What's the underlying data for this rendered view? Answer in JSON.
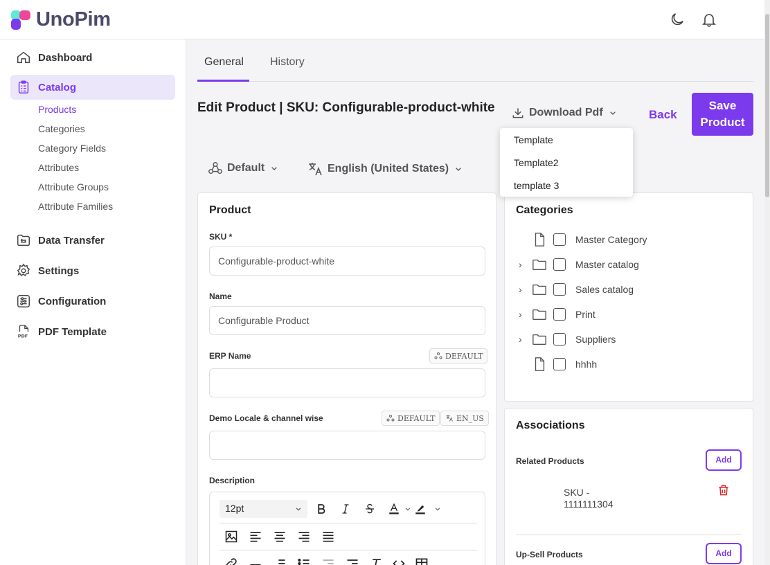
{
  "brand": {
    "name": "UnoPim"
  },
  "sidebar": {
    "items": [
      {
        "label": "Dashboard",
        "icon": "home-icon"
      },
      {
        "label": "Catalog",
        "icon": "clipboard-icon"
      },
      {
        "label": "Data Transfer",
        "icon": "folder-transfer-icon"
      },
      {
        "label": "Settings",
        "icon": "gear-icon"
      },
      {
        "label": "Configuration",
        "icon": "sliders-icon"
      },
      {
        "label": "PDF Template",
        "icon": "pdf-icon"
      }
    ],
    "catalog_sub": [
      "Products",
      "Categories",
      "Category Fields",
      "Attributes",
      "Attribute Groups",
      "Attribute Families"
    ]
  },
  "tabs": [
    "General",
    "History"
  ],
  "header": {
    "title": "Edit Product | SKU: Configurable-product-white",
    "download_label": "Download Pdf",
    "back_label": "Back",
    "save_label": "Save Product"
  },
  "download_menu": [
    "Template",
    "Template2",
    "template 3"
  ],
  "switchers": {
    "channel": "Default",
    "locale": "English (United States)"
  },
  "product_card": {
    "title": "Product",
    "sku_label": "SKU *",
    "sku_value": "Configurable-product-white",
    "name_label": "Name",
    "name_value": "Configurable Product",
    "erp_label": "ERP Name",
    "erp_chip": "DEFAULT",
    "demo_label": "Demo Locale & channel wise",
    "demo_chip_channel": "DEFAULT",
    "demo_chip_locale": "EN_US",
    "description_label": "Description",
    "font_size": "12pt"
  },
  "categories": {
    "title": "Categories",
    "items": [
      {
        "label": "Master Category",
        "type": "file",
        "expandable": false
      },
      {
        "label": "Master catalog",
        "type": "folder",
        "expandable": true
      },
      {
        "label": "Sales catalog",
        "type": "folder",
        "expandable": true
      },
      {
        "label": "Print",
        "type": "folder",
        "expandable": true
      },
      {
        "label": "Suppliers",
        "type": "folder",
        "expandable": true
      },
      {
        "label": "hhhh",
        "type": "file",
        "expandable": false
      }
    ]
  },
  "associations": {
    "title": "Associations",
    "related_label": "Related Products",
    "add_label": "Add",
    "related_sku": "SKU - 1111111304",
    "upsell_label": "Up-Sell Products"
  },
  "colors": {
    "accent": "#7c3aed",
    "accent_light": "#ece6fb",
    "delete": "#dc2626"
  }
}
